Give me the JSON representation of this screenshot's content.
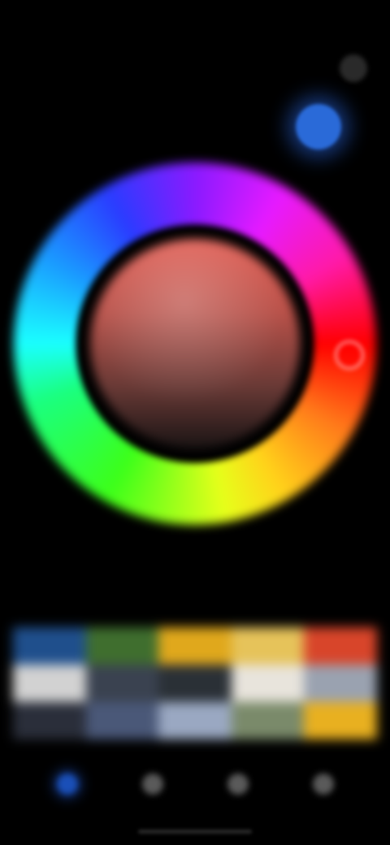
{
  "status_bar": {
    "time": ""
  },
  "header": {
    "title": ""
  },
  "current_color": {
    "color": "#2a6ad8"
  },
  "wheel": {
    "selected_hue_color": "#ff0000",
    "center_color": "#c05048"
  },
  "swatches": {
    "label": "",
    "colors": [
      "#1f4f8c",
      "#3f6e2e",
      "#e0a81c",
      "#e6c35a",
      "#d8452a",
      "#d2d2d2",
      "#3a4250",
      "#2a3036",
      "#e8e4dc",
      "#9aa2b0",
      "#2a2e3a",
      "#4a5878",
      "#9aa8c2",
      "#7a8a6a",
      "#e8b020"
    ]
  },
  "nav": {
    "items": [
      {
        "name": "nav-item-color",
        "icon": "color-dot-icon",
        "active": true
      },
      {
        "name": "nav-item-2",
        "icon": "circle-icon",
        "active": false
      },
      {
        "name": "nav-item-3",
        "icon": "circle-icon",
        "active": false
      },
      {
        "name": "nav-item-4",
        "icon": "circle-icon",
        "active": false
      }
    ]
  },
  "colors": {
    "background": "#000000",
    "accent": "#2a6ad8"
  }
}
